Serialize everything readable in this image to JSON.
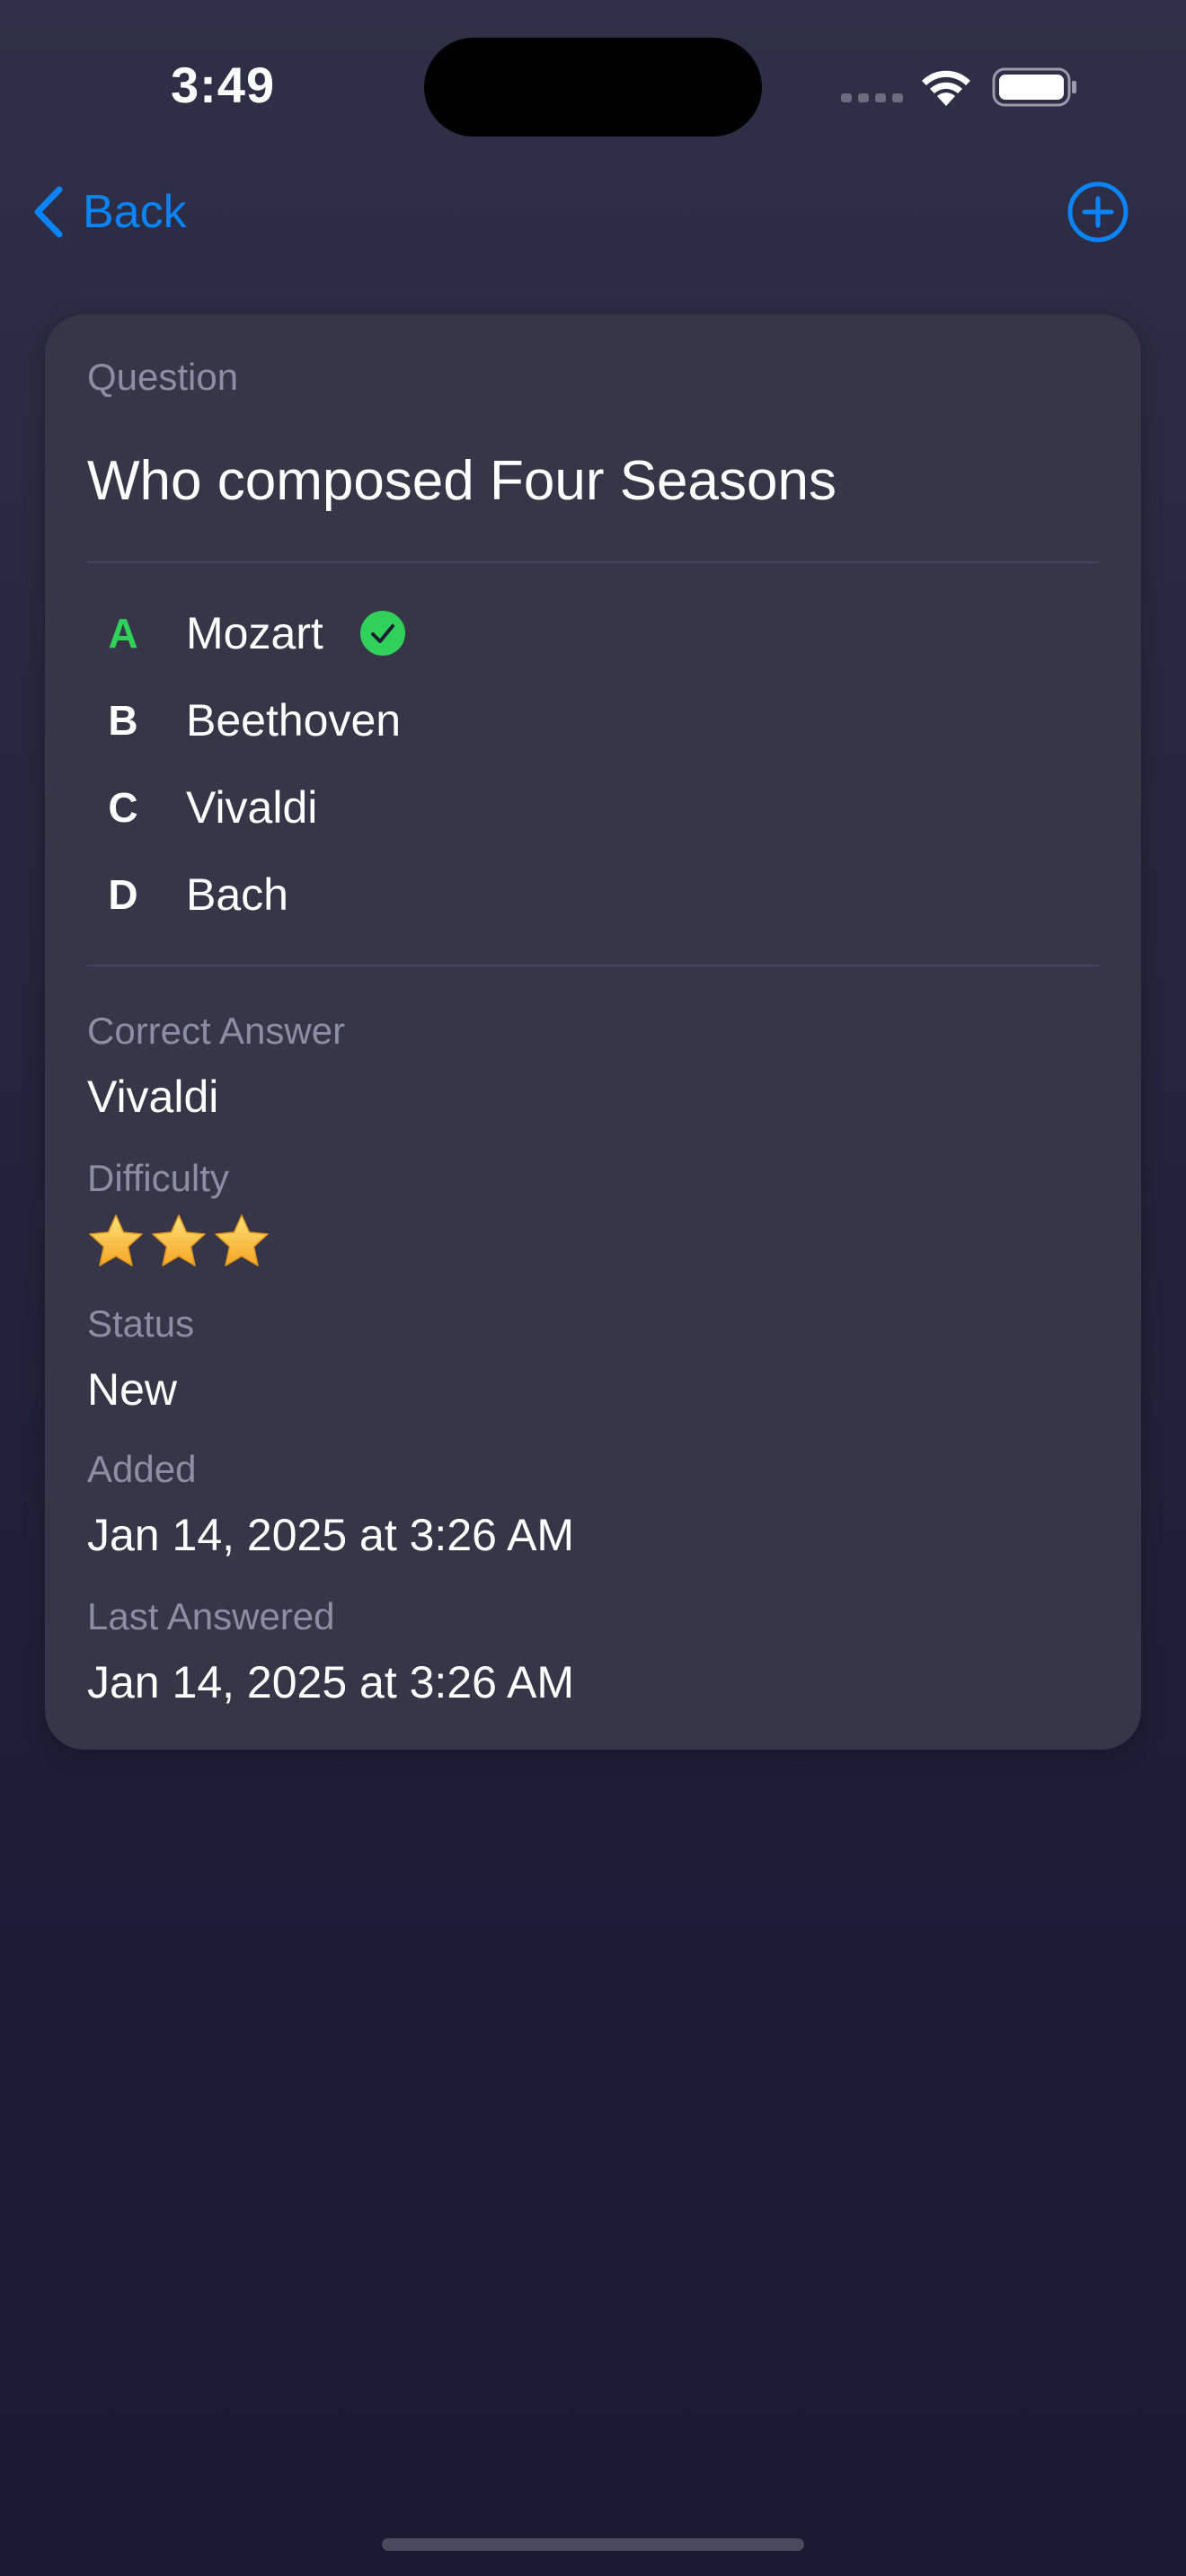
{
  "status_bar": {
    "time": "3:49",
    "wifi_icon": "wifi-icon",
    "battery_icon": "battery-icon"
  },
  "nav": {
    "back_label": "Back",
    "back_icon": "chevron-left-icon",
    "add_icon": "plus-circle-icon",
    "accent_color": "#0a84ff"
  },
  "card": {
    "question_label": "Question",
    "question_text": "Who composed Four Seasons",
    "options": [
      {
        "letter": "A",
        "text": "Mozart",
        "marked": true
      },
      {
        "letter": "B",
        "text": "Beethoven",
        "marked": false
      },
      {
        "letter": "C",
        "text": "Vivaldi",
        "marked": false
      },
      {
        "letter": "D",
        "text": "Bach",
        "marked": false
      }
    ],
    "correct_answer_label": "Correct Answer",
    "correct_answer_value": "Vivaldi",
    "difficulty_label": "Difficulty",
    "difficulty_stars": 3,
    "status_label": "Status",
    "status_value": "New",
    "added_label": "Added",
    "added_value": "Jan 14, 2025 at 3:26 AM",
    "last_answered_label": "Last Answered",
    "last_answered_value": "Jan 14, 2025 at 3:26 AM",
    "correct_color": "#30d158",
    "star_color": "#ffc83d"
  }
}
